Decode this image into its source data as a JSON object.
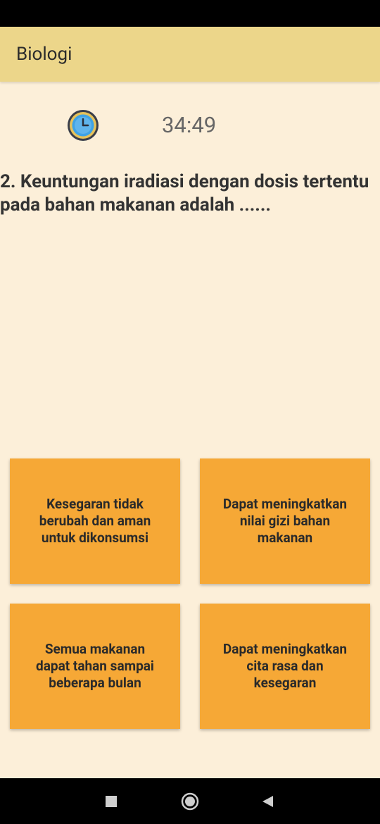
{
  "app_bar": {
    "title": "Biologi"
  },
  "timer": {
    "icon": "clock-icon",
    "value": "34:49"
  },
  "question": {
    "text": "2. Keuntungan iradiasi dengan dosis tertentu pada bahan makanan adalah ......"
  },
  "answers": [
    {
      "label": "Kesegaran tidak berubah dan aman untuk dikonsumsi"
    },
    {
      "label": "Dapat meningkatkan nilai gizi bahan makanan"
    },
    {
      "label": "Semua makanan dapat tahan sampai beberapa bulan"
    },
    {
      "label": "Dapat meningkatkan cita rasa dan kesegaran"
    }
  ],
  "nav": {
    "recents_icon": "square-icon",
    "home_icon": "circle-icon",
    "back_icon": "triangle-back-icon"
  },
  "colors": {
    "app_bar": "#ecd68a",
    "background": "#fcefd9",
    "answer_bg": "#f6a836"
  }
}
